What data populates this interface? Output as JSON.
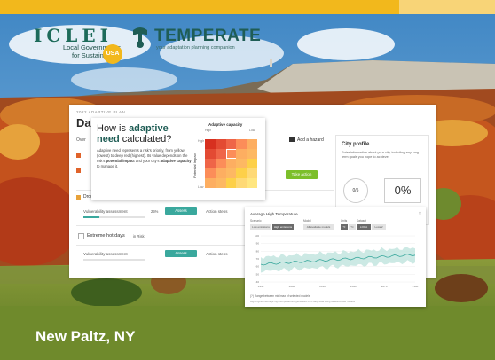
{
  "branding": {
    "iclei_word": "ICLEI",
    "iclei_subtitle": "Local Governments for Sustainability",
    "usa_badge": "USA",
    "temperate_title": "TEMPERATE",
    "temperate_tagline": "your adaptation planning companion"
  },
  "caption": "New Paltz, NY",
  "dashboard": {
    "eyebrow": "2022 ADAPTIVE PLAN",
    "title": "Das",
    "overview_label": "Over",
    "add_hazard": "Add a hazard",
    "rows": [
      {
        "label": "Drought",
        "sub": "In Now"
      },
      {
        "label": "Extreme hot days",
        "sub": "in Risk"
      }
    ],
    "take_action": "Take action",
    "vulnerability_label": "Vulnerability assessment",
    "percent_small": "25%",
    "assess_button": "Assess",
    "action_steps": "Action steps",
    "city_profile": {
      "title": "City profile",
      "description": "Enter information about your city, including any long-term goals you hope to achieve.",
      "circle_value": "0/5",
      "percent": "0%"
    }
  },
  "popup": {
    "heading_pre": "How is ",
    "heading_bold": "adaptive need",
    "heading_post": " calculated?",
    "body_pre": "Adaptive need represents a risk's priority, from yellow (lowest) to deep red (highest). Its value depends on the risk's ",
    "body_b1": "potential impact",
    "body_mid": " and your city's ",
    "body_b2": "adaptive capacity",
    "body_post": " to manage it.",
    "heatmap_title": "Adaptive capacity",
    "y_axis": "Potential Impact",
    "high": "High",
    "low": "Low",
    "x_high": "High",
    "x_low": "Low"
  },
  "modal": {
    "title": "Average High Temperature",
    "group_scenario": "Scenario",
    "group_model": "Model",
    "group_units": "Units",
    "group_dataset": "Dataset",
    "scenario_opts": [
      "Low emissions",
      "High emissions"
    ],
    "model_opt": "All available models",
    "units_opts": [
      "°F",
      "°C"
    ],
    "dataset_opts": [
      "LOCA",
      "Loca 2"
    ],
    "y_ticks": [
      "100",
      "90",
      "80",
      "70",
      "60",
      "50",
      "40"
    ],
    "x_ticks": [
      "1950",
      "1980",
      "2010",
      "2040",
      "2070",
      "2100"
    ],
    "footer": "(?) Range between min/max of selected models",
    "footer2": "High/highest average high temperatures, generated from daily data using all associated models"
  },
  "colors": {
    "top_bar": "#f2b81c",
    "top_bar_light": "#f8d477",
    "teal": "#3aa89d",
    "green": "#7cbf2a",
    "heat_high": "#d7301f",
    "heat_low": "#fed976"
  }
}
